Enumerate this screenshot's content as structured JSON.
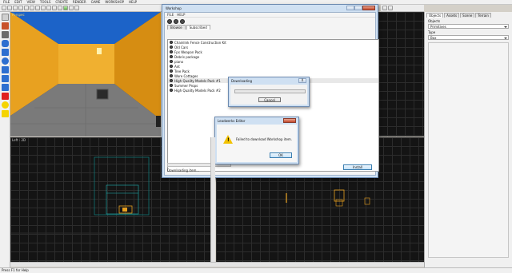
{
  "menubar": [
    "FILE",
    "EDIT",
    "VIEW",
    "TOOLS",
    "CREATE",
    "RENDER",
    "GAME",
    "WORKSHOP",
    "HELP"
  ],
  "viewports": {
    "perspective_label": "Perspec",
    "left_label": "Left - 2D"
  },
  "workshop": {
    "title": "Workshop",
    "menu": [
      "FILE",
      "HELP"
    ],
    "tabs": [
      "Browse",
      "Subscribed"
    ],
    "active_tab": "Subscribed",
    "items": [
      "Chainlink Fence Construction Kit",
      "Old Cars",
      "Fps Weapon Pack",
      "Debris package",
      "piano",
      "Ant",
      "Tree Pack",
      "Wore Cottages",
      "High Quality Models Pack #1",
      "Summer Props",
      "High Quality Models Pack #2"
    ],
    "selected_item": "High Quality Models Pack #1",
    "status": "Downloading item...",
    "install_label": "Install"
  },
  "download_dialog": {
    "title": "Downloading",
    "close_label": "X",
    "progress": 0.0,
    "cancel_label": "Cancel"
  },
  "error_dialog": {
    "title": "Leadwerks Editor",
    "message": "Failed to download Workshop item.",
    "ok_label": "OK"
  },
  "right_panel": {
    "tabs": [
      "Objects",
      "Assets",
      "Scene",
      "Terrain"
    ],
    "active_tab": "Objects",
    "objects_label": "Objects",
    "objects_value": "Primitives",
    "type_label": "Type",
    "type_value": "Box"
  },
  "statusbar": "Press F1 for Help",
  "colors": {
    "wall_orange": "#e8a120",
    "ceiling_blue": "#1c63c8",
    "floor_grey": "#7a7a7a",
    "grid_bg": "#141414",
    "window_frame": "#cfe0f2",
    "progress_green": "#7ccd5b"
  }
}
